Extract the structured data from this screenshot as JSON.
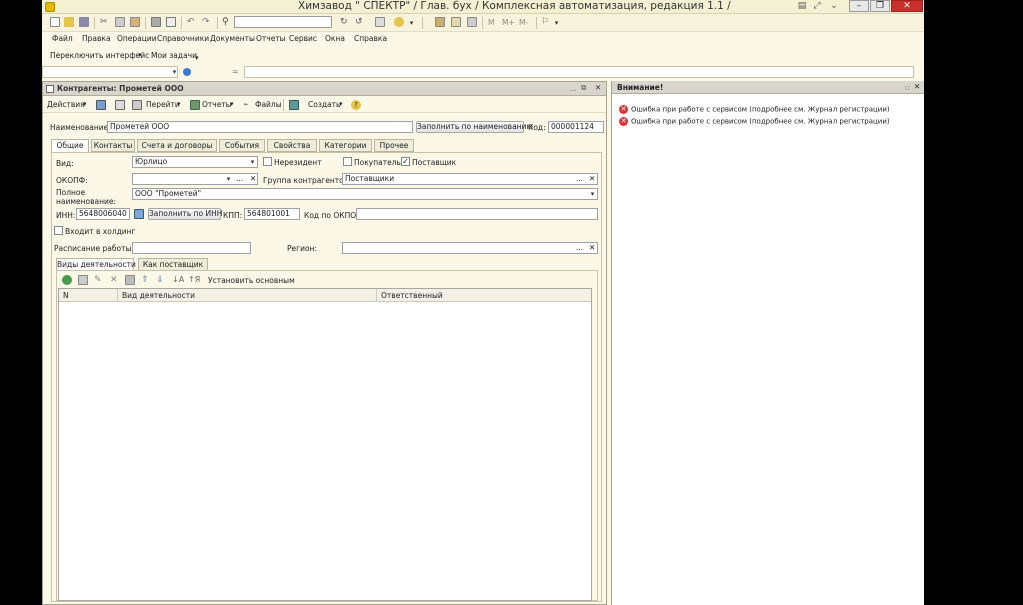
{
  "window": {
    "title": "Химзавод \" СПЕКТР\" / Глав. бух / Комплексная автоматизация, редакция 1.1 /"
  },
  "toolbar": {
    "search_value": "",
    "m_label": "M",
    "mplus_label": "M+",
    "mminus_label": "M-"
  },
  "menu": {
    "items": [
      "Файл",
      "Правка",
      "Операции",
      "Справочники",
      "Документы",
      "Отчеты",
      "Сервис",
      "Окна",
      "Справка"
    ]
  },
  "panel_bar": {
    "switch_interface": "Переключить интерфейс",
    "my_tasks": "Мои задачи"
  },
  "form": {
    "title": "Контрагенты: Прометей ООО",
    "toolbar": {
      "actions": "Действия",
      "go": "Перейти",
      "reports": "Отчеты",
      "files": "Файлы",
      "create": "Создать"
    },
    "name_label": "Наименование:",
    "name_value": "Прометей ООО",
    "fill_by_name": "Заполнить по наименованию",
    "code_label": "Код:",
    "code_value": "000001124",
    "tabs": [
      "Общие",
      "Контакты",
      "Счета и договоры",
      "События",
      "Свойства",
      "Категории",
      "Прочее"
    ],
    "kind_label": "Вид:",
    "kind_value": "Юрлицо",
    "nonresident_label": "Нерезидент",
    "buyer_label": "Покупатель",
    "supplier_label": "Поставщик",
    "okopf_label": "ОКОПФ:",
    "okopf_value": "",
    "group_label": "Группа контрагентов:",
    "group_value": "Поставщики",
    "fullname_label": "Полное наименование:",
    "fullname_value": "ООО \"Прометей\"",
    "inn_label": "ИНН:",
    "inn_value": "5648006040",
    "fill_by_inn": "Заполнить по ИНН",
    "kpp_label": "КПП:",
    "kpp_value": "564801001",
    "okpo_label": "Код по ОКПО:",
    "okpo_value": "",
    "holding_label": "Входит в холдинг",
    "schedule_label": "Расписание работы:",
    "region_label": "Регион:",
    "subtabs": [
      "Виды деятельности",
      "Как поставщик"
    ],
    "set_main": "Установить основным",
    "table_headers": [
      "N",
      "Вид деятельности",
      "Ответственный"
    ]
  },
  "attention": {
    "title": "Внимание!",
    "messages": [
      "Ошибка при работе с сервисом (подробнее см. Журнал регистрации)",
      "Ошибка при работе с сервисом (подробнее см. Журнал регистрации)"
    ]
  }
}
